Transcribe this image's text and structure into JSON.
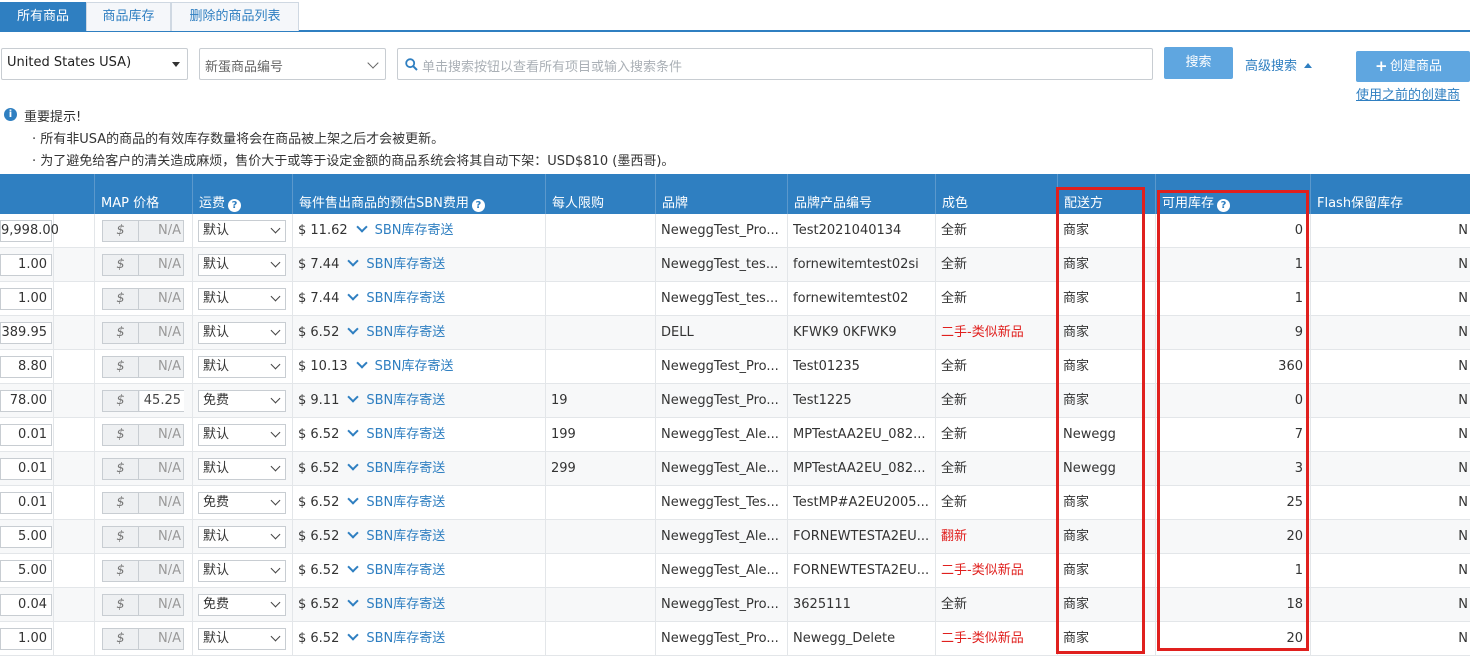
{
  "tabs": [
    "所有商品",
    "商品库存",
    "删除的商品列表"
  ],
  "filters": {
    "country": "United States USA)",
    "field": "新蛋商品编号",
    "search_placeholder": "单击搜索按钮以查看所有项目或输入搜索条件",
    "search_button": "搜索",
    "advanced_search": "高级搜索",
    "create_button": "创建商品",
    "use_previous": "使用之前的创建商"
  },
  "notice": {
    "title": "重要提示!",
    "line1": "· 所有非USA的商品的有效库存数量将会在商品被上架之后才会被更新。",
    "line2": "· 为了避免给客户的清关造成麻烦，售价大于或等于设定金额的商品系统会将其自动下架：USD$810 (墨西哥)。"
  },
  "columns": {
    "map": "MAP 价格",
    "shipping": "运费",
    "sbn_fee": "每件售出商品的预估SBN费用",
    "limit": "每人限购",
    "brand": "品牌",
    "mfr_part": "品牌产品编号",
    "condition": "成色",
    "fulfilled_by": "配送方",
    "available": "可用库存",
    "flash": "Flash保留库存"
  },
  "currency_symbol": "$",
  "sbn_link_text": "SBN库存寄送",
  "rows": [
    {
      "price": "9,998.00",
      "map": "N/A",
      "map_enabled": false,
      "ship": "默认",
      "fee": "$ 11.62",
      "limit": "",
      "brand": "NeweggTest_Pro...",
      "part": "Test2021040134",
      "cond": "全新",
      "cond_red": false,
      "by": "商家",
      "stock": "0",
      "flash": "N"
    },
    {
      "price": "1.00",
      "map": "N/A",
      "map_enabled": false,
      "ship": "默认",
      "fee": "$ 7.44",
      "limit": "",
      "brand": "NeweggTest_tes...",
      "part": "fornewitemtest02si",
      "cond": "全新",
      "cond_red": false,
      "by": "商家",
      "stock": "1",
      "flash": "N"
    },
    {
      "price": "1.00",
      "map": "N/A",
      "map_enabled": false,
      "ship": "默认",
      "fee": "$ 7.44",
      "limit": "",
      "brand": "NeweggTest_tes...",
      "part": "fornewitemtest02",
      "cond": "全新",
      "cond_red": false,
      "by": "商家",
      "stock": "1",
      "flash": "N"
    },
    {
      "price": "389.95",
      "map": "N/A",
      "map_enabled": false,
      "ship": "默认",
      "fee": "$ 6.52",
      "limit": "",
      "brand": "DELL",
      "part": "KFWK9 0KFWK9",
      "cond": "二手-类似新品",
      "cond_red": true,
      "by": "商家",
      "stock": "9",
      "flash": "N"
    },
    {
      "price": "8.80",
      "map": "N/A",
      "map_enabled": false,
      "ship": "默认",
      "fee": "$ 10.13",
      "limit": "",
      "brand": "NeweggTest_Pro...",
      "part": "Test01235",
      "cond": "全新",
      "cond_red": false,
      "by": "商家",
      "stock": "360",
      "flash": "N"
    },
    {
      "price": "78.00",
      "map": "45.25",
      "map_enabled": true,
      "ship": "免费",
      "fee": "$ 9.11",
      "limit": "19",
      "brand": "NeweggTest_Pro...",
      "part": "Test1225",
      "cond": "全新",
      "cond_red": false,
      "by": "商家",
      "stock": "0",
      "flash": "N"
    },
    {
      "price": "0.01",
      "map": "N/A",
      "map_enabled": false,
      "ship": "默认",
      "fee": "$ 6.52",
      "limit": "199",
      "brand": "NeweggTest_Ale...",
      "part": "MPTestAA2EU_082...",
      "cond": "全新",
      "cond_red": false,
      "by": "Newegg",
      "stock": "7",
      "flash": "N"
    },
    {
      "price": "0.01",
      "map": "N/A",
      "map_enabled": false,
      "ship": "默认",
      "fee": "$ 6.52",
      "limit": "299",
      "brand": "NeweggTest_Ale...",
      "part": "MPTestAA2EU_082...",
      "cond": "全新",
      "cond_red": false,
      "by": "Newegg",
      "stock": "3",
      "flash": "N"
    },
    {
      "price": "0.01",
      "map": "N/A",
      "map_enabled": false,
      "ship": "免费",
      "fee": "$ 6.52",
      "limit": "",
      "brand": "NeweggTest_Tes...",
      "part": "TestMP#A2EU2005...",
      "cond": "全新",
      "cond_red": false,
      "by": "商家",
      "stock": "25",
      "flash": "N"
    },
    {
      "price": "5.00",
      "map": "N/A",
      "map_enabled": false,
      "ship": "默认",
      "fee": "$ 6.52",
      "limit": "",
      "brand": "NeweggTest_Ale...",
      "part": "FORNEWTESTA2EU...",
      "cond": "翻新",
      "cond_red": true,
      "by": "商家",
      "stock": "20",
      "flash": "N"
    },
    {
      "price": "5.00",
      "map": "N/A",
      "map_enabled": false,
      "ship": "默认",
      "fee": "$ 6.52",
      "limit": "",
      "brand": "NeweggTest_Ale...",
      "part": "FORNEWTESTA2EU...",
      "cond": "二手-类似新品",
      "cond_red": true,
      "by": "商家",
      "stock": "1",
      "flash": "N"
    },
    {
      "price": "0.04",
      "map": "N/A",
      "map_enabled": false,
      "ship": "免费",
      "fee": "$ 6.52",
      "limit": "",
      "brand": "NeweggTest_Pro...",
      "part": "3625111",
      "cond": "全新",
      "cond_red": false,
      "by": "商家",
      "stock": "18",
      "flash": "N"
    },
    {
      "price": "1.00",
      "map": "N/A",
      "map_enabled": false,
      "ship": "默认",
      "fee": "$ 6.52",
      "limit": "",
      "brand": "NeweggTest_Pro...",
      "part": "Newegg_Delete",
      "cond": "二手-类似新品",
      "cond_red": true,
      "by": "商家",
      "stock": "20",
      "flash": "N"
    }
  ],
  "colors": {
    "primary": "#2f7fc1",
    "button": "#5fa6e0",
    "highlight": "#e0201e",
    "condition_red": "#e0201e"
  }
}
